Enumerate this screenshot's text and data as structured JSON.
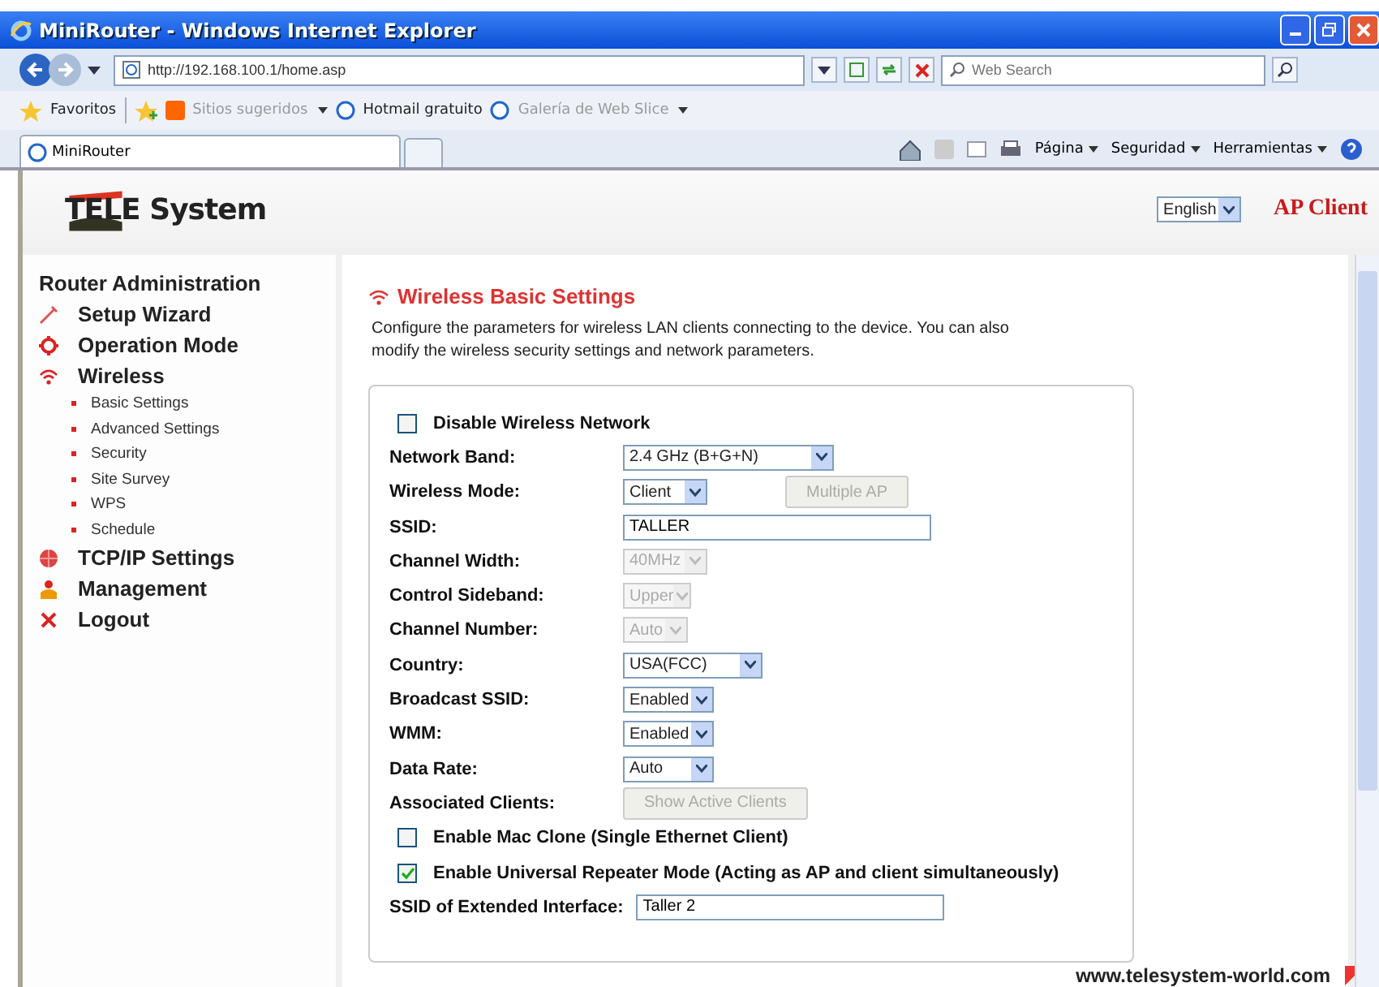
{
  "window": {
    "title": "MiniRouter - Windows Internet Explorer"
  },
  "address_bar": {
    "url": "http://192.168.100.1/home.asp",
    "search_placeholder": "Web Search"
  },
  "favorites_bar": {
    "label": "Favoritos",
    "items": [
      {
        "label": "Sitios sugeridos",
        "dropdown": true,
        "disabled": true
      },
      {
        "label": "Hotmail gratuito",
        "dropdown": false,
        "disabled": false
      },
      {
        "label": "Galería de Web Slice",
        "dropdown": true,
        "disabled": true
      }
    ]
  },
  "tab": {
    "label": "MiniRouter"
  },
  "command_bar": {
    "menus": [
      "Página",
      "Seguridad",
      "Herramientas"
    ]
  },
  "header": {
    "logo": "TELE System",
    "language": "English",
    "mode": "AP Client"
  },
  "sidebar": {
    "title": "Router Administration",
    "items": [
      {
        "label": "Setup Wizard"
      },
      {
        "label": "Operation Mode"
      },
      {
        "label": "Wireless",
        "children": [
          {
            "label": "Basic Settings"
          },
          {
            "label": "Advanced Settings"
          },
          {
            "label": "Security"
          },
          {
            "label": "Site Survey"
          },
          {
            "label": "WPS"
          },
          {
            "label": "Schedule"
          }
        ]
      },
      {
        "label": "TCP/IP Settings"
      },
      {
        "label": "Management"
      },
      {
        "label": "Logout"
      }
    ]
  },
  "main": {
    "title": "Wireless Basic Settings",
    "description": "Configure the parameters for wireless LAN clients connecting to the device. You can also modify the wireless security settings and network parameters.",
    "rows": [
      {
        "kind": "checkbox",
        "label": "Disable Wireless Network",
        "checked": false
      },
      {
        "kind": "select",
        "label": "Network Band:",
        "value": "2.4 GHz (B+G+N)",
        "disabled": false
      },
      {
        "kind": "select",
        "label": "Wireless Mode:",
        "value": "Client",
        "disabled": false,
        "button": "Multiple AP"
      },
      {
        "kind": "text",
        "label": "SSID:",
        "value": "TALLER"
      },
      {
        "kind": "select",
        "label": "Channel Width:",
        "value": "40MHz",
        "disabled": true
      },
      {
        "kind": "select",
        "label": "Control Sideband:",
        "value": "Upper",
        "disabled": true
      },
      {
        "kind": "select",
        "label": "Channel Number:",
        "value": "Auto",
        "disabled": true
      },
      {
        "kind": "select",
        "label": "Country:",
        "value": "USA(FCC)",
        "disabled": false
      },
      {
        "kind": "select",
        "label": "Broadcast SSID:",
        "value": "Enabled",
        "disabled": false
      },
      {
        "kind": "select",
        "label": "WMM:",
        "value": "Enabled",
        "disabled": false
      },
      {
        "kind": "select",
        "label": "Data Rate:",
        "value": "Auto",
        "disabled": false
      },
      {
        "kind": "button",
        "label": "Associated Clients:",
        "button": "Show Active Clients"
      },
      {
        "kind": "checkbox",
        "label": "Enable Mac Clone (Single Ethernet Client)",
        "checked": false
      },
      {
        "kind": "checkbox",
        "label": "Enable Universal Repeater Mode (Acting as AP and client simultaneously)",
        "checked": true
      },
      {
        "kind": "text",
        "label": "SSID of Extended Interface:",
        "value": "Taller 2"
      }
    ]
  },
  "footer": {
    "url": "www.telesystem-world.com"
  }
}
